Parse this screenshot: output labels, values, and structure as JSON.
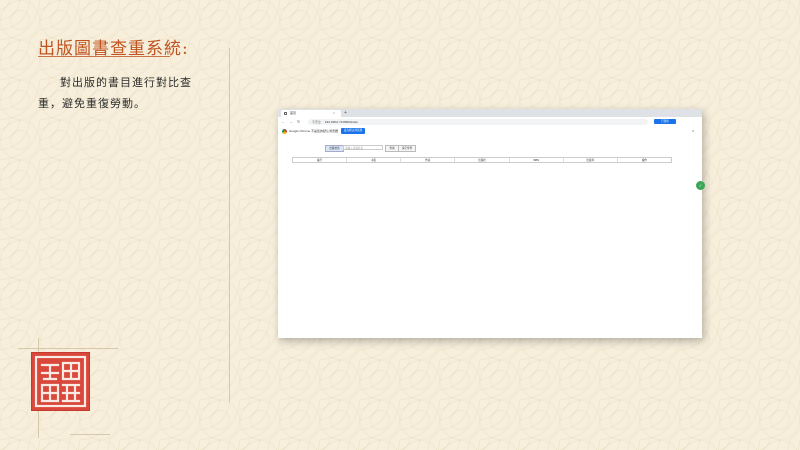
{
  "slide": {
    "title": "出版圖書查重系統:",
    "body": "對出版的書目進行對比查重，避免重復勞動。"
  },
  "browser": {
    "tab_title": "首页",
    "tab_close": "×",
    "new_tab": "+",
    "nav": {
      "back": "←",
      "forward": "→",
      "reload": "↻"
    },
    "address": {
      "security": "不安全",
      "url": "192.168.0.73:8000/index"
    },
    "profile_label": "已暂停",
    "infobar": {
      "message": "Google Chrome 不是您的默认浏览器",
      "button": "设为默认浏览器",
      "close": "×"
    }
  },
  "app": {
    "search_label": "出版社名",
    "search_placeholder": "请输入出版社名",
    "query_button": "查询",
    "clear_button": "清空条件",
    "table_headers": [
      "编号",
      "书名",
      "作者",
      "出版社",
      "ISBN",
      "出版年",
      "操作"
    ]
  },
  "colors": {
    "title": "#c0531f",
    "seal": "#d9483b",
    "accent": "#1a73e8",
    "page_bg": "#f7efdc"
  }
}
